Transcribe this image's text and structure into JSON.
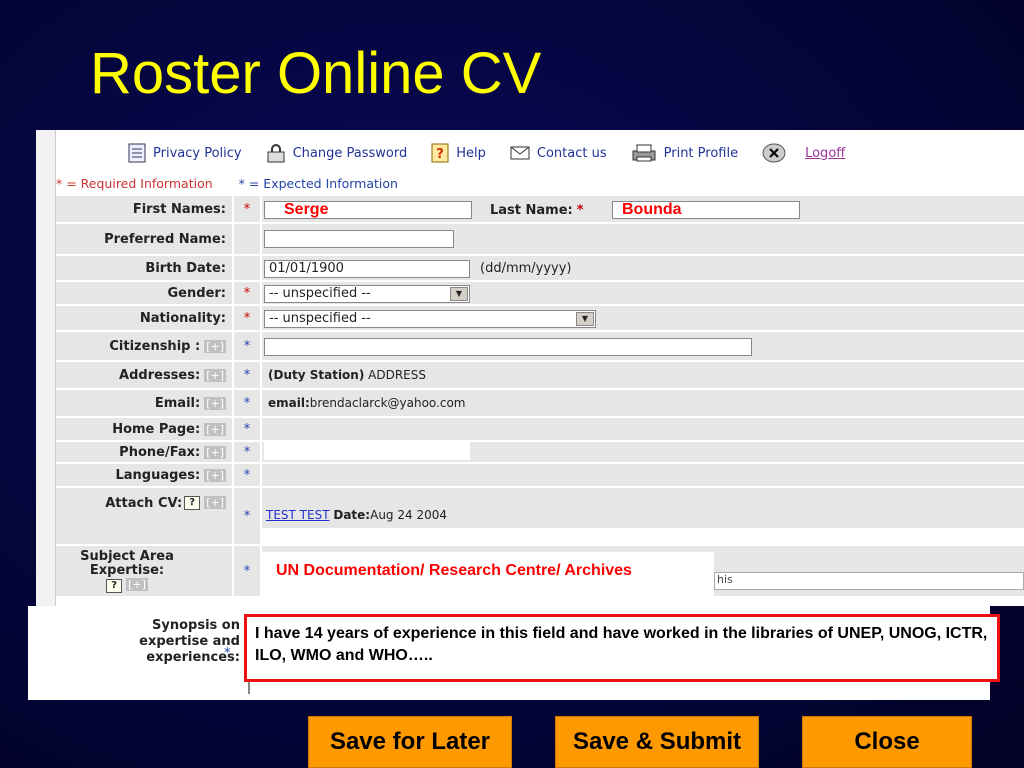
{
  "slide": {
    "title": "Roster Online CV"
  },
  "nav": {
    "privacy": "Privacy Policy",
    "change_password": "Change Password",
    "help": "Help",
    "contact": "Contact us",
    "print": "Print Profile",
    "logoff": "Logoff"
  },
  "legend": {
    "required": "* = Required Information",
    "expected": "* = Expected Information"
  },
  "form": {
    "first_names_label": "First Names:",
    "first_names_value": "Serge",
    "last_name_label": "Last Name:",
    "last_name_value": "Bounda",
    "preferred_name_label": "Preferred Name:",
    "birth_date_label": "Birth Date:",
    "birth_date_value": "01/01/1900",
    "birth_date_hint": "(dd/mm/yyyy)",
    "gender_label": "Gender:",
    "gender_value": "-- unspecified --",
    "nationality_label": "Nationality:",
    "nationality_value": "-- unspecified --",
    "citizenship_label": "Citizenship :",
    "addresses_label": "Addresses:",
    "addresses_prefix": "(Duty Station)",
    "addresses_value": "ADDRESS",
    "email_label": "Email:",
    "email_prefix": "email:",
    "email_value": "brendaclarck@yahoo.com",
    "homepage_label": "Home Page:",
    "phone_label": "Phone/Fax:",
    "languages_label": "Languages:",
    "attach_cv_label": "Attach CV:",
    "cv_link": "TEST TEST",
    "cv_date_label": "Date:",
    "cv_date_value": "Aug 24 2004",
    "subject_label_1": "Subject Area",
    "subject_label_2": "Expertise:",
    "subject_value": "UN Documentation/ Research Centre/ Archives",
    "subject_tail": "his",
    "plus": "[+]",
    "star": "*"
  },
  "synopsis": {
    "label_1": "Synopsis on",
    "label_2": "expertise and",
    "label_3": "experiences:",
    "text": "I have 14 years of experience in this field and have worked in the libraries of UNEP, UNOG, ICTR, ILO, WMO and WHO….."
  },
  "buttons": {
    "save_later": "Save for Later",
    "save_submit": "Save & Submit",
    "close": "Close"
  }
}
